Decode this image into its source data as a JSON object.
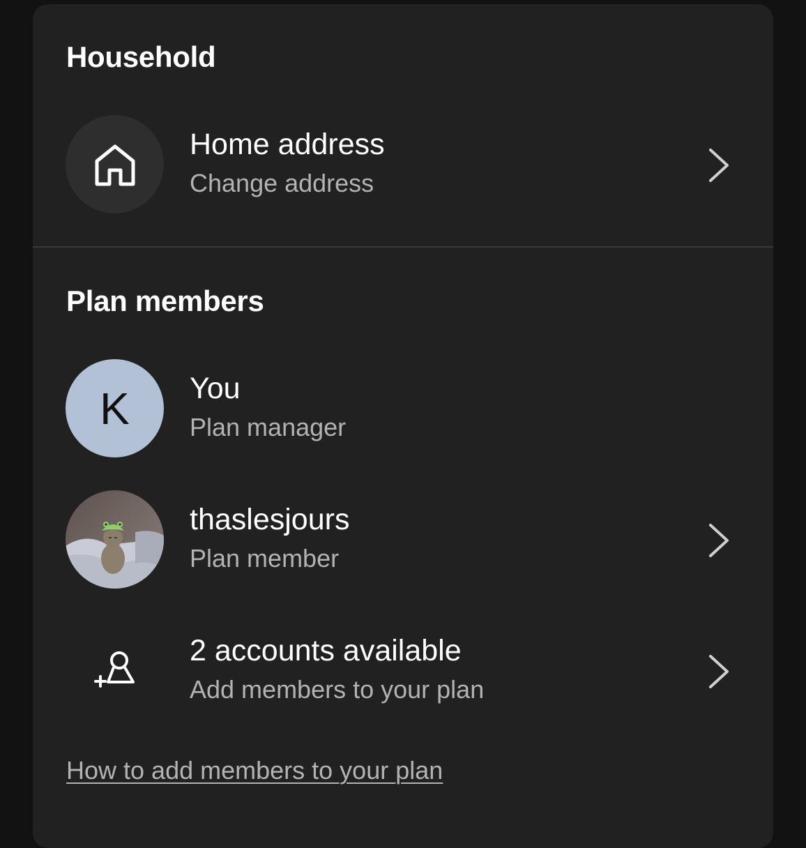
{
  "household": {
    "title": "Household",
    "home_address": {
      "label": "Home address",
      "sublabel": "Change address",
      "icon": "home-icon"
    }
  },
  "plan_members": {
    "title": "Plan members",
    "members": [
      {
        "initial": "K",
        "name": "You",
        "role": "Plan manager"
      },
      {
        "name": "thaslesjours",
        "role": "Plan member",
        "avatar": "cat-photo"
      }
    ],
    "add_members": {
      "label": "2 accounts available",
      "sublabel": "Add members to your plan",
      "icon": "add-user-icon"
    },
    "help_link": "How to add members to your plan"
  },
  "colors": {
    "background": "#121212",
    "card": "#212121",
    "avatar_initial_bg": "#b2c1d6",
    "secondary_text": "#b3b3b3"
  }
}
